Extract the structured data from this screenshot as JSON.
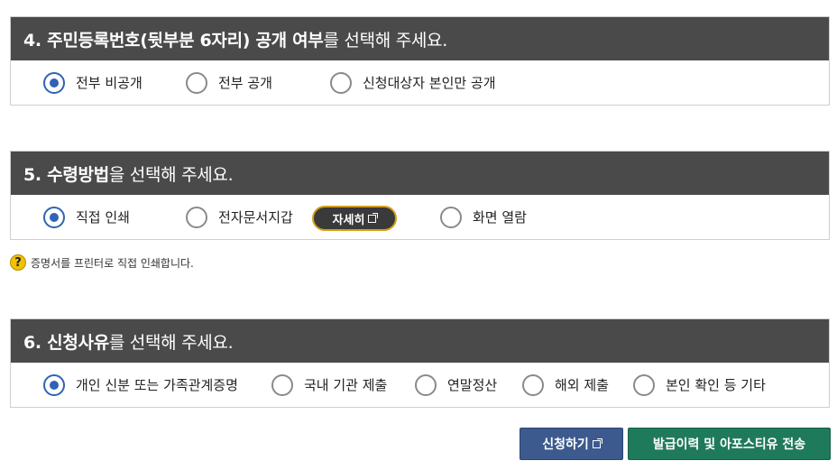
{
  "section4": {
    "title_bold": "4. 주민등록번호(뒷부분 6자리) 공개 여부",
    "title_rest": "를 선택해 주세요.",
    "options": [
      {
        "label": "전부 비공개",
        "checked": true
      },
      {
        "label": "전부 공개",
        "checked": false
      },
      {
        "label": "신청대상자 본인만 공개",
        "checked": false
      }
    ]
  },
  "section5": {
    "title_bold": "5. 수령방법",
    "title_rest": "을 선택해 주세요.",
    "options": [
      {
        "label": "직접 인쇄",
        "checked": true
      },
      {
        "label": "전자문서지갑",
        "checked": false
      },
      {
        "label": "화면 열람",
        "checked": false
      }
    ],
    "detail_label": "자세히",
    "help_icon": "?",
    "help_text": "증명서를 프린터로 직접 인쇄합니다."
  },
  "section6": {
    "title_bold": "6. 신청사유",
    "title_rest": "를 선택해 주세요.",
    "options": [
      {
        "label": "개인 신분 또는 가족관계증명",
        "checked": true
      },
      {
        "label": "국내 기관 제출",
        "checked": false
      },
      {
        "label": "연말정산",
        "checked": false
      },
      {
        "label": "해외 제출",
        "checked": false
      },
      {
        "label": "본인 확인 등 기타",
        "checked": false
      }
    ]
  },
  "buttons": {
    "apply_label": "신청하기",
    "history_label": "발급이력 및 아포스티유 전송"
  },
  "colors": {
    "header_bg": "#4a4a4a",
    "radio_checked": "#2f63b3",
    "apply_bg": "#3c5a8e",
    "history_bg": "#1f7a5c",
    "detail_border": "#d4a017"
  }
}
